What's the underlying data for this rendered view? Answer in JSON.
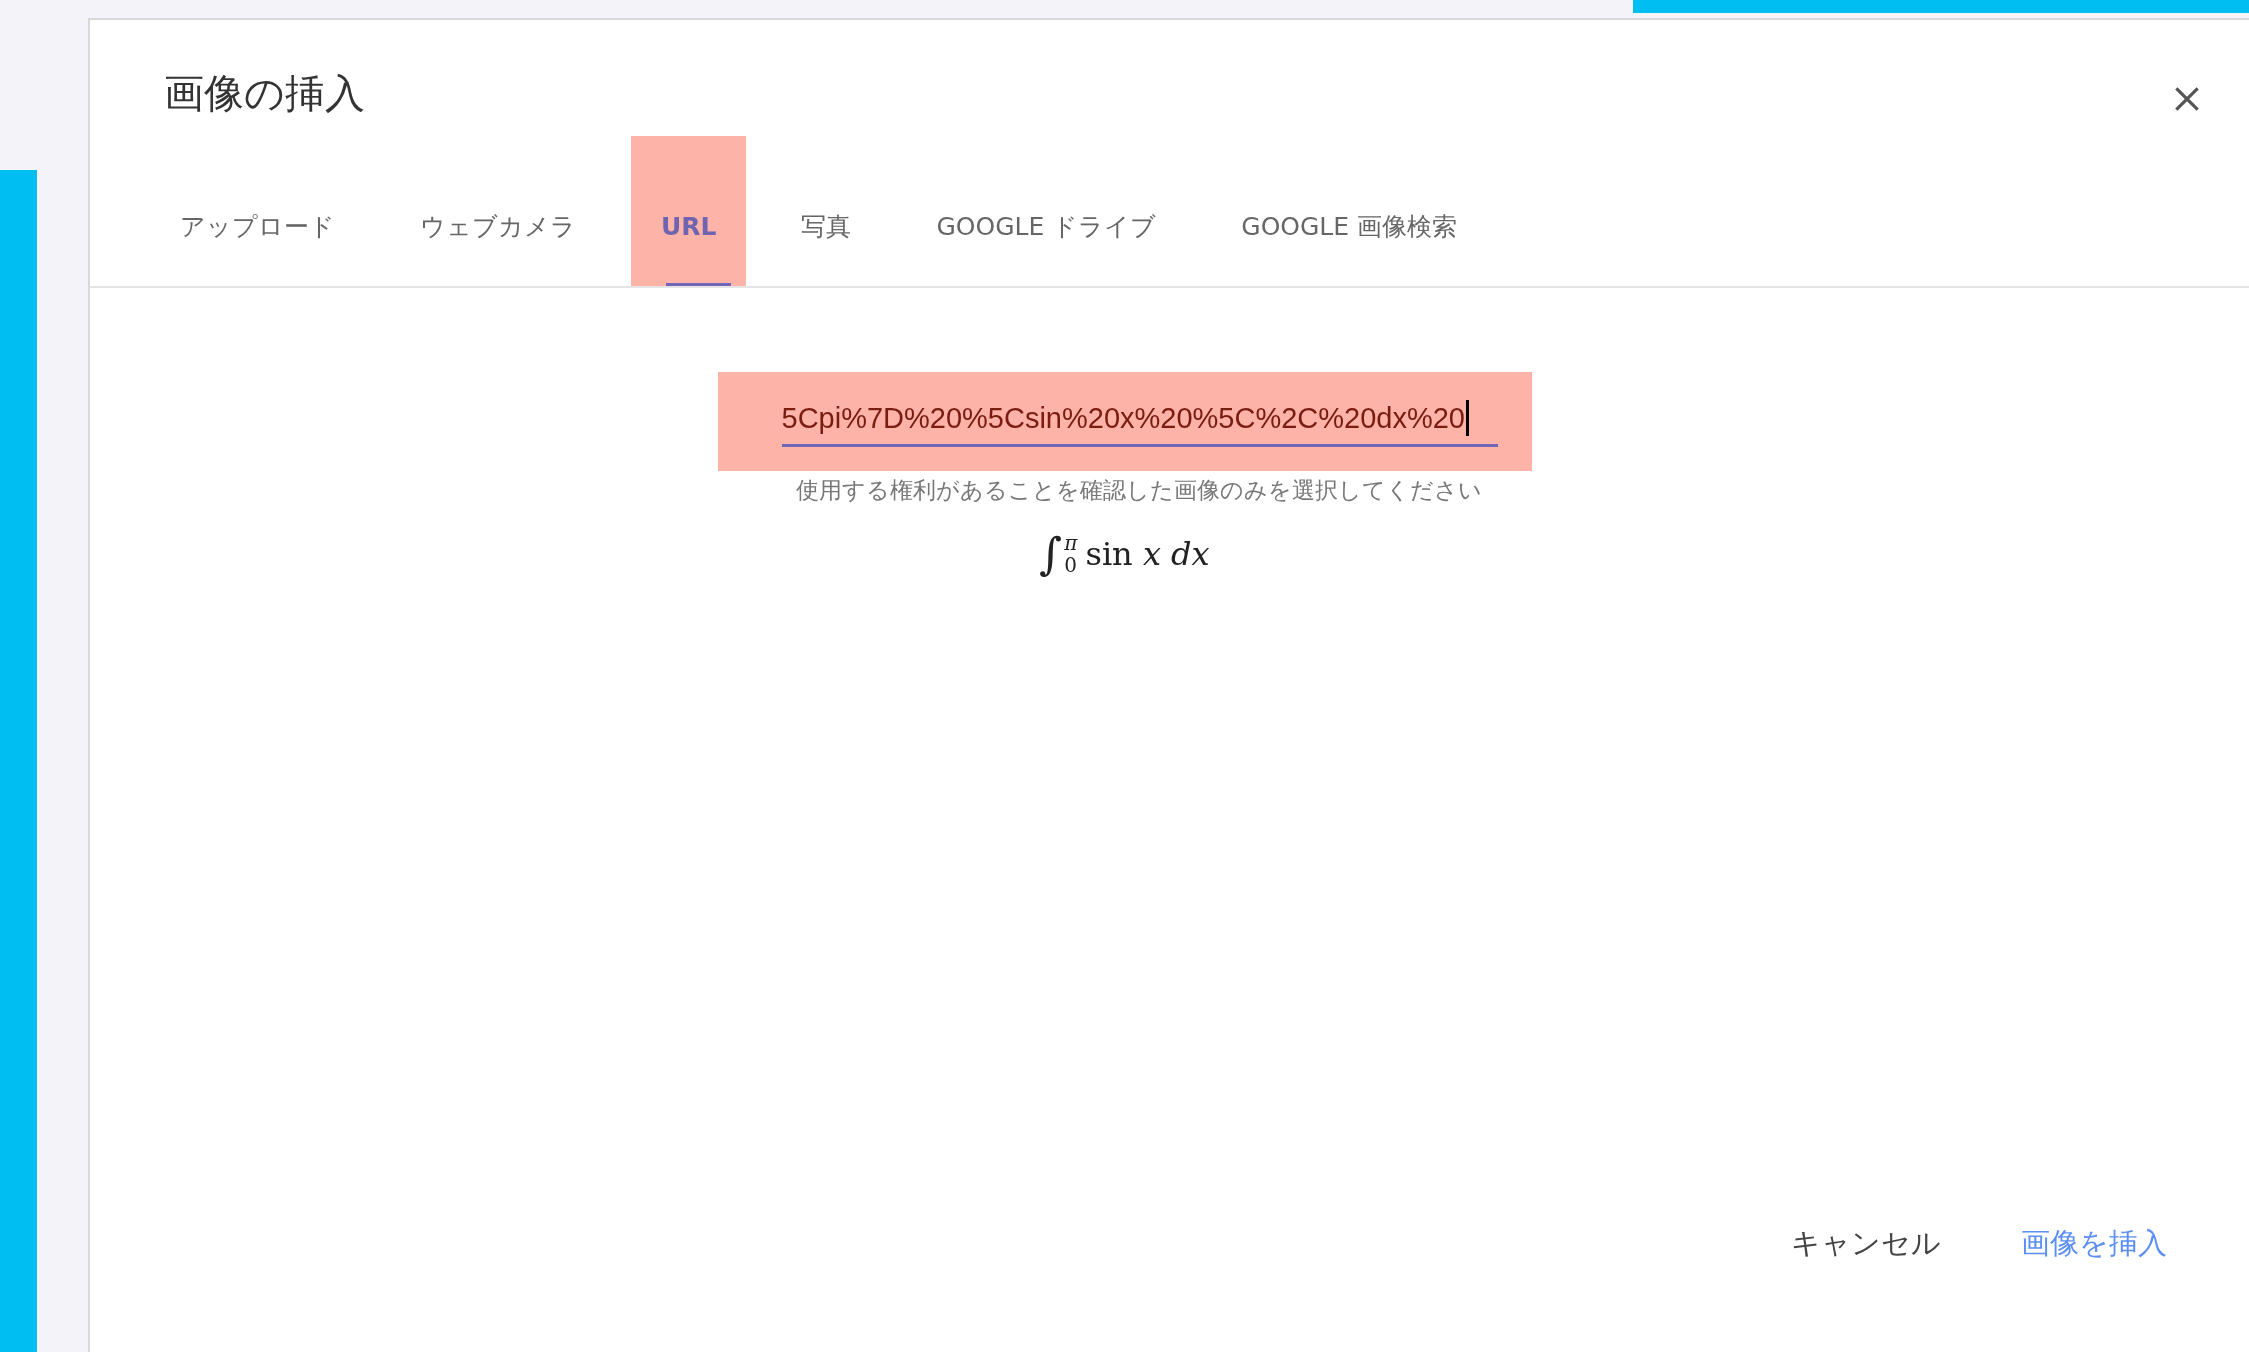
{
  "dialog": {
    "title": "画像の挿入",
    "tabs": [
      {
        "label": "アップロード",
        "selected": false,
        "highlighted": false
      },
      {
        "label": "ウェブカメラ",
        "selected": false,
        "highlighted": false
      },
      {
        "label": "URL",
        "selected": true,
        "highlighted": true
      },
      {
        "label": "写真",
        "selected": false,
        "highlighted": false
      },
      {
        "label": "GOOGLE ドライブ",
        "selected": false,
        "highlighted": false
      },
      {
        "label": "GOOGLE 画像検索",
        "selected": false,
        "highlighted": false
      }
    ],
    "url_field": {
      "value": "5Cpi%7D%20%5Csin%20x%20%5C%2C%20dx%20",
      "highlighted": true,
      "focused": true
    },
    "hint": "使用する権利があることを確認した画像のみを選択してください",
    "preview": {
      "operator": "∫",
      "upper": "π",
      "lower": "0",
      "integrand": "sin *x* *dx*"
    },
    "buttons": [
      {
        "label": "キャンセル",
        "kind": "secondary"
      },
      {
        "label": "画像を挿入",
        "kind": "primary"
      }
    ]
  }
}
